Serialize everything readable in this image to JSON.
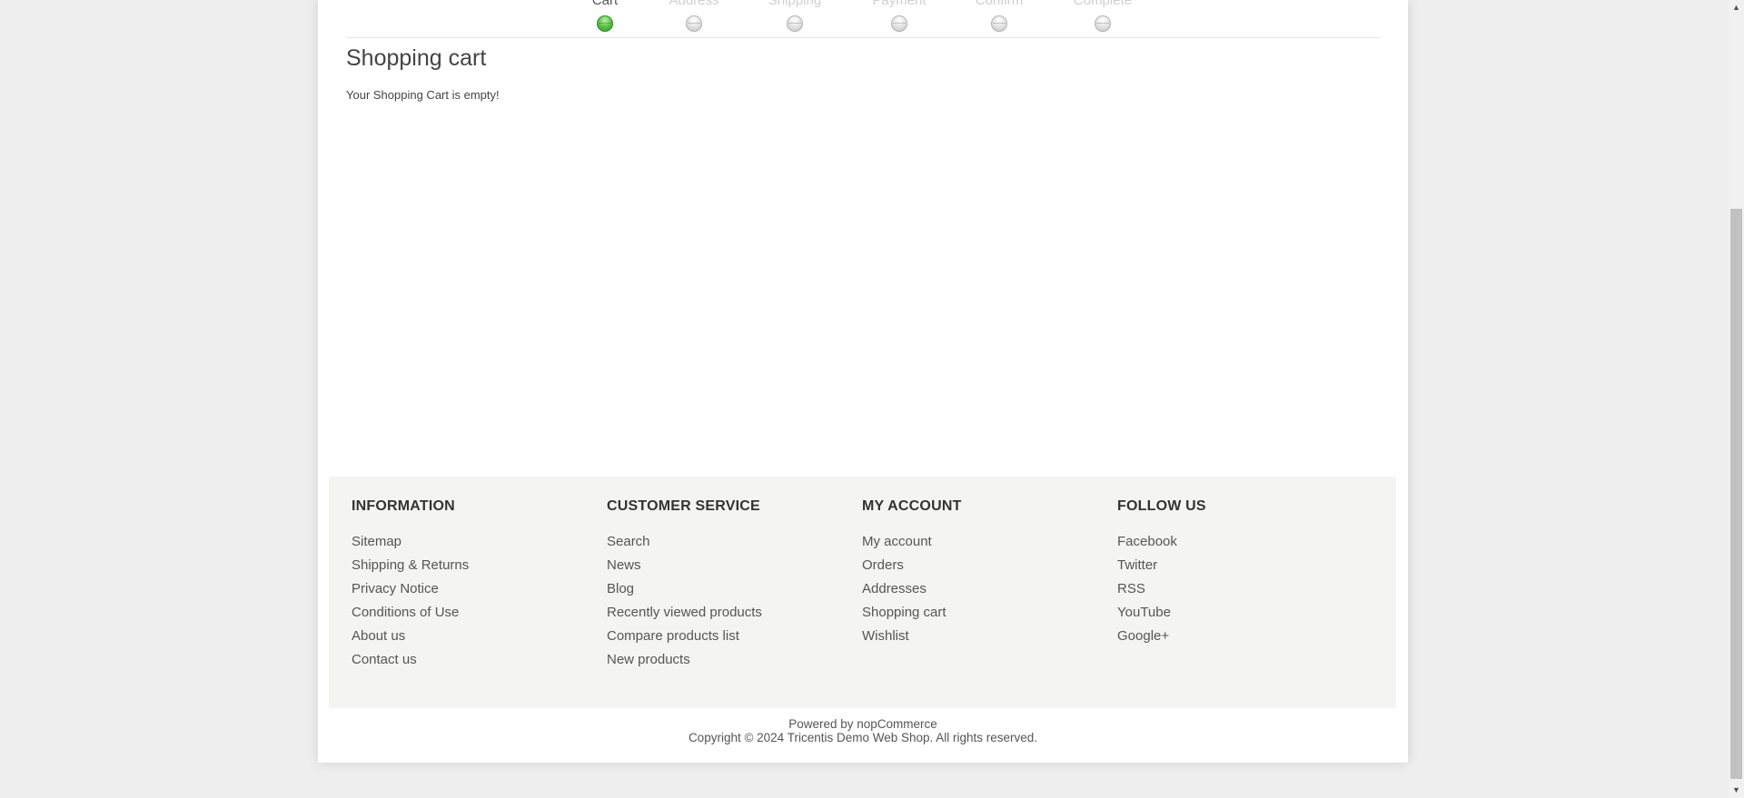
{
  "checkout_steps": [
    {
      "label": "Cart",
      "active": true
    },
    {
      "label": "Address",
      "active": false
    },
    {
      "label": "Shipping",
      "active": false
    },
    {
      "label": "Payment",
      "active": false
    },
    {
      "label": "Confirm",
      "active": false
    },
    {
      "label": "Complete",
      "active": false
    }
  ],
  "main": {
    "title": "Shopping cart",
    "empty_message": "Your Shopping Cart is empty!"
  },
  "footer": {
    "information": {
      "heading": "INFORMATION",
      "links": [
        "Sitemap",
        "Shipping & Returns",
        "Privacy Notice",
        "Conditions of Use",
        "About us",
        "Contact us"
      ]
    },
    "customer_service": {
      "heading": "CUSTOMER SERVICE",
      "links": [
        "Search",
        "News",
        "Blog",
        "Recently viewed products",
        "Compare products list",
        "New products"
      ]
    },
    "my_account": {
      "heading": "MY ACCOUNT",
      "links": [
        "My account",
        "Orders",
        "Addresses",
        "Shopping cart",
        "Wishlist"
      ]
    },
    "follow_us": {
      "heading": "FOLLOW US",
      "links": [
        "Facebook",
        "Twitter",
        "RSS",
        "YouTube",
        "Google+"
      ]
    },
    "powered_by": "Powered by nopCommerce",
    "copyright": "Copyright © 2024 Tricentis Demo Web Shop. All rights reserved."
  },
  "colors": {
    "active_step": "#4cb33c",
    "inactive_step": "#d3d3d3",
    "page_background": "#eeeeee",
    "footer_background": "#f4f4f2"
  },
  "icons": {
    "scroll_up": "scroll-up-arrow-icon",
    "scroll_down": "scroll-down-arrow-icon",
    "step_indicator": "step-indicator-icon"
  }
}
